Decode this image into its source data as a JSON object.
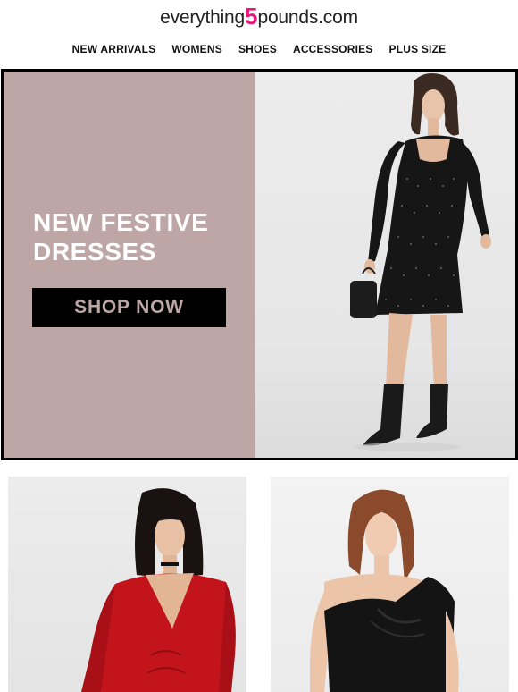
{
  "logo": {
    "prefix": "everything",
    "number": "5",
    "suffix": "pounds.com"
  },
  "nav": {
    "items": [
      {
        "label": "NEW ARRIVALS"
      },
      {
        "label": "WOMENS"
      },
      {
        "label": "SHOES"
      },
      {
        "label": "ACCESSORIES"
      },
      {
        "label": "PLUS SIZE"
      }
    ]
  },
  "hero": {
    "title_line1": "NEW FESTIVE",
    "title_line2": "DRESSES",
    "button_label": "SHOP NOW",
    "panel_color": "#bea5a6"
  },
  "products": [
    {
      "image": "model-red-velvet-dress"
    },
    {
      "image": "model-black-one-shoulder-dress"
    }
  ],
  "colors": {
    "brand_accent": "#e8197a",
    "text": "#111111",
    "hero_panel": "#bea5a6"
  }
}
